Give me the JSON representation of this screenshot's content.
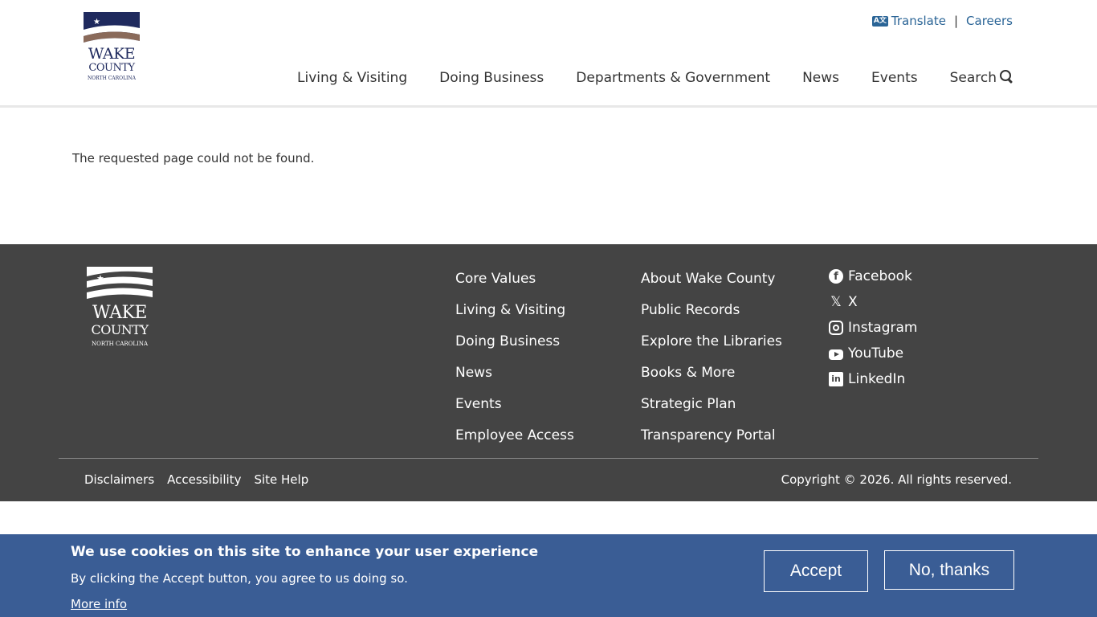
{
  "header": {
    "logo": {
      "wake": "WAKE",
      "county": "COUNTY",
      "state": "NORTH CAROLINA"
    },
    "utility": {
      "translate": "Translate",
      "separator": "|",
      "careers": "Careers"
    },
    "nav": [
      {
        "label": "Living & Visiting"
      },
      {
        "label": "Doing Business"
      },
      {
        "label": "Departments & Government"
      },
      {
        "label": "News"
      },
      {
        "label": "Events"
      },
      {
        "label": "Search"
      }
    ]
  },
  "main": {
    "message": "The requested page could not be found."
  },
  "footer": {
    "logo": {
      "wake": "WAKE",
      "county": "COUNTY",
      "state": "NORTH CAROLINA"
    },
    "col1": [
      "Core Values",
      "Living & Visiting",
      "Doing Business",
      "News",
      "Events",
      "Employee Access"
    ],
    "col2": [
      "About Wake County",
      "Public Records",
      "Explore the Libraries",
      "Books & More",
      "Strategic Plan",
      "Transparency Portal"
    ],
    "social": [
      {
        "label": "Facebook",
        "icon": "facebook-icon"
      },
      {
        "label": "X",
        "icon": "x-icon"
      },
      {
        "label": "Instagram",
        "icon": "instagram-icon"
      },
      {
        "label": "YouTube",
        "icon": "youtube-icon"
      },
      {
        "label": "LinkedIn",
        "icon": "linkedin-icon"
      }
    ],
    "legal": [
      "Disclaimers",
      "Accessibility",
      "Site Help"
    ],
    "copyright": "Copyright © 2026. All rights reserved."
  },
  "cookie": {
    "title": "We use cookies on this site to enhance your user experience",
    "text": "By clicking the Accept button, you agree to us doing so.",
    "more": "More info",
    "accept": "Accept",
    "decline": "No, thanks"
  },
  "colors": {
    "navy": "#1f2a5e",
    "brown": "#8a6a5a",
    "link": "#2a6496",
    "footer_bg": "#444444",
    "cookie_bg": "#3a5d95"
  }
}
